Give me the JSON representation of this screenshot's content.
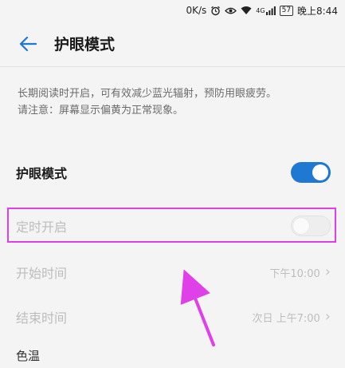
{
  "status_bar": {
    "network_speed": "0K/s",
    "signal_text": "4G",
    "battery": "57",
    "time": "晚上8:44"
  },
  "header": {
    "title": "护眼模式"
  },
  "description": {
    "line1": "长期阅读时开启，可有效减少蓝光辐射，预防用眼疲劳。",
    "line2": "请注意：屏幕显示偏黄为正常现象。"
  },
  "settings": {
    "eye_mode": {
      "label": "护眼模式",
      "enabled": true
    },
    "scheduled": {
      "label": "定时开启",
      "enabled": false
    },
    "start_time": {
      "label": "开始时间",
      "value": "下午10:00"
    },
    "end_time": {
      "label": "结束时间",
      "value": "次日 上午7:00"
    },
    "color_temp": {
      "label": "色温"
    }
  },
  "annotation": {
    "highlight_color": "#e040e8",
    "accent_color": "#1f78d1"
  }
}
